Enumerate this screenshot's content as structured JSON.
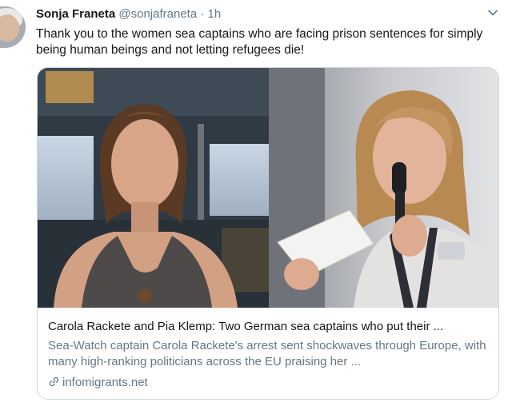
{
  "tweet": {
    "author_name": "Sonja Franeta",
    "author_handle": "@sonjafraneta",
    "separator": "·",
    "time": "1h",
    "text": "Thank you to the women sea captains who are facing prison sentences for simply being human beings and not letting refugees die!"
  },
  "card": {
    "title": "Carola Rackete and Pia Klemp: Two German sea captains who put their ...",
    "description": "Sea-Watch captain Carola Rackete's arrest sent shockwaves through Europe, with many high-ranking politicians across the EU praising her ...",
    "domain": "infomigrants.net"
  },
  "icons": {
    "more": "chevron-down-icon",
    "link": "link-icon"
  },
  "colors": {
    "text": "#14171a",
    "secondary": "#657786",
    "border": "#ccd6dd"
  }
}
